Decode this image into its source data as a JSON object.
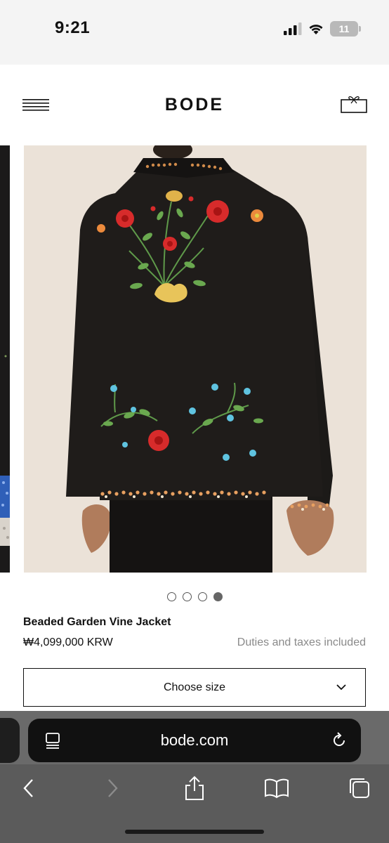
{
  "status_bar": {
    "time": "9:21",
    "battery_level": "11",
    "icons": [
      "cellular-signal-icon",
      "wifi-icon",
      "battery-icon"
    ]
  },
  "header": {
    "logo": "BODE",
    "menu_icon": "hamburger-menu-icon",
    "cart_icon": "gift-box-cart-icon"
  },
  "gallery": {
    "slide_count": 4,
    "active_slide": 4,
    "image_subject": "black jacket back with embroidered flowers and beaded trim"
  },
  "product": {
    "name": "Beaded Garden Vine Jacket",
    "price": "₩4,099,000 KRW",
    "duties_note": "Duties and taxes included",
    "size_select_label": "Choose size"
  },
  "browser": {
    "url": "bode.com",
    "toolbar_icons": [
      "back-icon",
      "forward-icon",
      "share-icon",
      "bookmarks-icon",
      "tabs-icon"
    ]
  },
  "colors": {
    "background": "#ffffff",
    "status_bar": "#f4f4f4",
    "text": "#111111",
    "muted_text": "#8a8a8a",
    "photo_backdrop": "#ebe2d8",
    "jacket": "#1c1a18",
    "browser_chrome": "#5b5b5b"
  }
}
